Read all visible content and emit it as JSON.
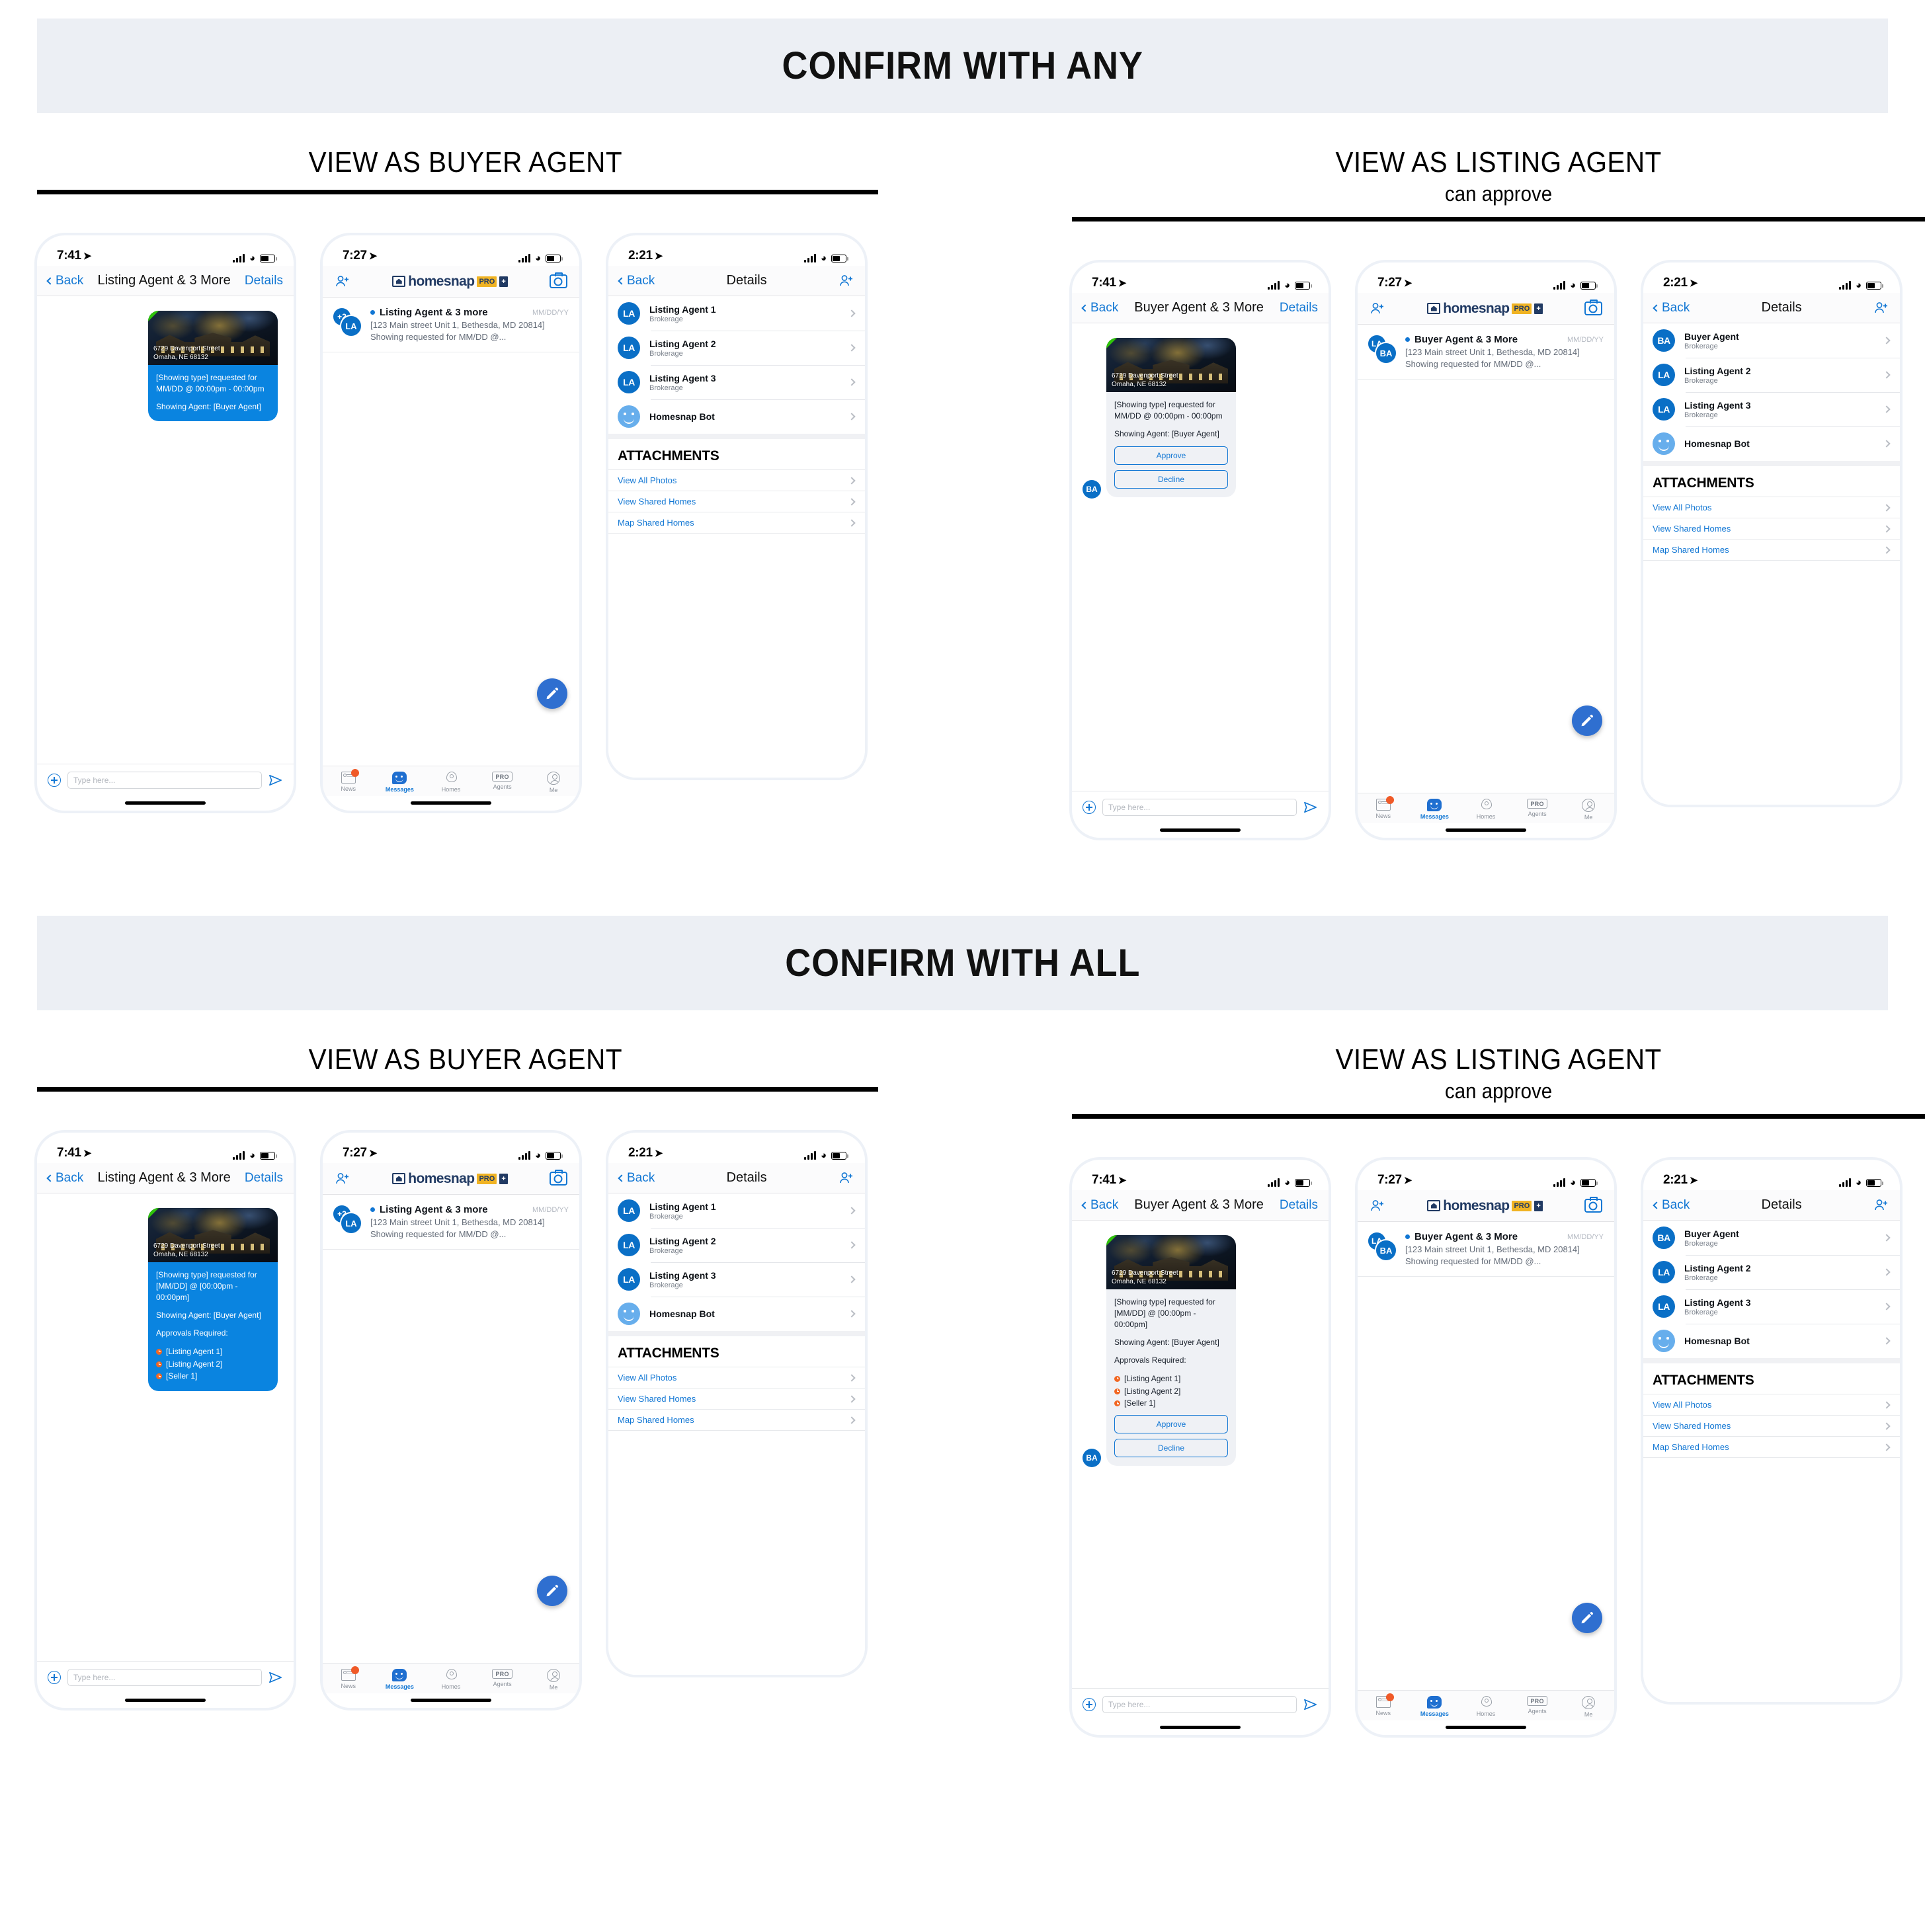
{
  "sections": [
    {
      "banner": "CONFIRM WITH ANY",
      "left_col": {
        "title": "VIEW AS BUYER AGENT",
        "sub": ""
      },
      "right_col": {
        "title": "VIEW AS LISTING AGENT",
        "sub": "can approve"
      }
    },
    {
      "banner": "CONFIRM WITH ALL",
      "left_col": {
        "title": "VIEW AS BUYER AGENT",
        "sub": ""
      },
      "right_col": {
        "title": "VIEW AS LISTING AGENT",
        "sub": "can approve"
      }
    }
  ],
  "status_bar": {
    "time_chat": "7:41",
    "time_list": "7:27",
    "time_details": "2:21"
  },
  "buyer_chat": {
    "back": "Back",
    "title": "Listing Agent & 3 More",
    "details": "Details",
    "property_address_line1": "6729 Davenport Street",
    "property_address_line2": "Omaha, NE 68132",
    "msg_any_line1": "[Showing type] requested for",
    "msg_any_line2": "MM/DD @ 00:00pm - 00:00pm",
    "msg_agent": "Showing Agent: [Buyer Agent]",
    "msg_all_line1": "[Showing type] requested for",
    "msg_all_line2": "[MM/DD] @ [00:00pm - 00:00pm]",
    "approvals_label": "Approvals Required:",
    "approvals": [
      "[Listing Agent 1]",
      "[Listing Agent 2]",
      "[Seller 1]"
    ],
    "compose_placeholder": "Type here..."
  },
  "listing_chat": {
    "back": "Back",
    "title": "Buyer Agent & 3 More",
    "details": "Details",
    "avatar": "BA",
    "approve": "Approve",
    "decline": "Decline",
    "compose_placeholder": "Type here..."
  },
  "message_list": {
    "logo_word": "homesnap",
    "logo_pro": "PRO",
    "logo_plus": "+",
    "buyer_conv": {
      "avatar_back": "+2",
      "avatar_front": "LA",
      "name": "Listing Agent & 3 more",
      "date": "MM/DD/YY",
      "sub_line1": "[123 Main street Unit 1, Bethesda, MD 20814]",
      "sub_line2": "Showing requested for MM/DD @..."
    },
    "listing_conv": {
      "avatar_back": "LA",
      "avatar_front": "BA",
      "name": "Buyer Agent & 3 More",
      "date": "MM/DD/YY",
      "sub_line1": "[123 Main street Unit 1, Bethesda, MD 20814]",
      "sub_line2": "Showing requested for MM/DD @..."
    },
    "tabs": [
      {
        "label": "News",
        "icon": "news-icon",
        "active": false
      },
      {
        "label": "Messages",
        "icon": "messages-icon",
        "active": true
      },
      {
        "label": "Homes",
        "icon": "homes-pin-icon",
        "active": false
      },
      {
        "label": "Agents",
        "icon": "pro-badge-icon",
        "active": false
      },
      {
        "label": "Me",
        "icon": "person-icon",
        "active": false
      }
    ]
  },
  "details_screen": {
    "back": "Back",
    "title": "Details",
    "brokerage": "Brokerage",
    "attachments_title": "ATTACHMENTS",
    "attachment_links": [
      "View All Photos",
      "View Shared Homes",
      "Map Shared Homes"
    ],
    "buyer_view_people": [
      {
        "initials": "LA",
        "name": "Listing Agent 1",
        "sub": "Brokerage",
        "type": "agent"
      },
      {
        "initials": "LA",
        "name": "Listing Agent 2",
        "sub": "Brokerage",
        "type": "agent"
      },
      {
        "initials": "LA",
        "name": "Listing Agent 3",
        "sub": "Brokerage",
        "type": "agent"
      },
      {
        "initials": "",
        "name": "Homesnap Bot",
        "sub": "",
        "type": "bot"
      }
    ],
    "listing_view_people": [
      {
        "initials": "BA",
        "name": "Buyer Agent",
        "sub": "Brokerage",
        "type": "agent"
      },
      {
        "initials": "LA",
        "name": "Listing Agent 2",
        "sub": "Brokerage",
        "type": "agent"
      },
      {
        "initials": "LA",
        "name": "Listing Agent 3",
        "sub": "Brokerage",
        "type": "agent"
      },
      {
        "initials": "",
        "name": "Homesnap Bot",
        "sub": "",
        "type": "bot"
      }
    ]
  },
  "colors": {
    "accent_blue": "#1277d4",
    "bubble_blue": "#0a84e0",
    "bubble_gray": "#eff1f5",
    "banner_bg": "#eceff4",
    "pending_orange": "#f26722",
    "logo_navy": "#213a63",
    "logo_gold": "#f0b323"
  }
}
